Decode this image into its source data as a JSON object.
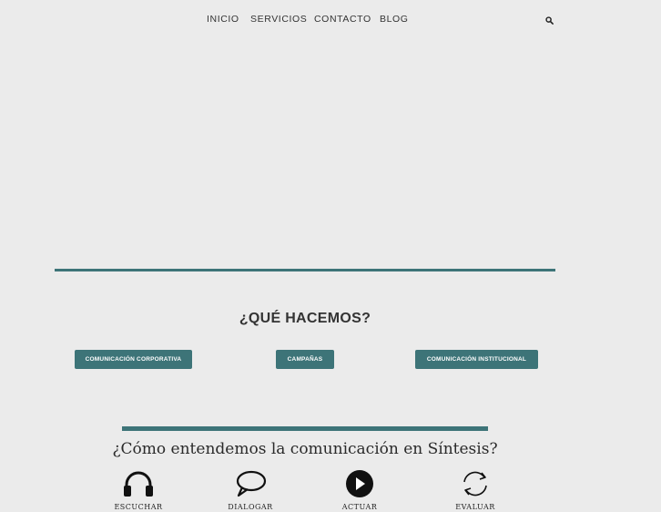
{
  "nav": {
    "items": [
      {
        "label": "INICIO"
      },
      {
        "label": "SERVICIOS"
      },
      {
        "label": "CONTACTO"
      },
      {
        "label": "BLOG"
      }
    ]
  },
  "section": {
    "title": "¿QUÉ HACEMOS?",
    "buttons": [
      {
        "label": "COMUNICACIÓN CORPORATIVA"
      },
      {
        "label": "CAMPAÑAS"
      },
      {
        "label": "COMUNICACIÓN INSTITUCIONAL"
      }
    ]
  },
  "graphic": {
    "title": "¿Cómo entendemos la comunicación en Síntesis?",
    "features": [
      {
        "label": "ESCUCHAR",
        "icon": "headphones-icon"
      },
      {
        "label": "DIALOGAR",
        "icon": "speech-bubble-icon"
      },
      {
        "label": "ACTUAR",
        "icon": "play-icon"
      },
      {
        "label": "EVALUAR",
        "icon": "refresh-icon"
      }
    ]
  },
  "colors": {
    "accent": "#3d7478",
    "background": "#ebebeb",
    "text": "#333333"
  }
}
